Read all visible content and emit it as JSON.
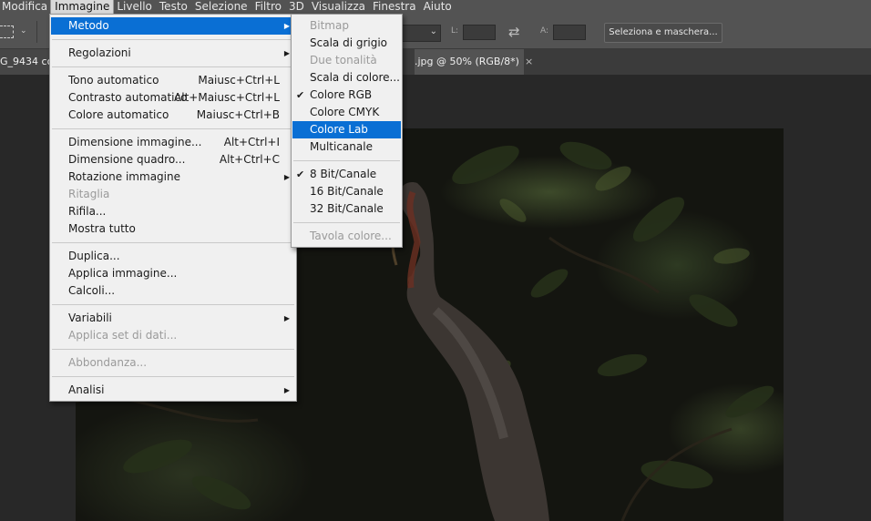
{
  "menubar": {
    "items": [
      "Modifica",
      "Immagine",
      "Livello",
      "Testo",
      "Selezione",
      "Filtro",
      "3D",
      "Visualizza",
      "Finestra",
      "Aiuto"
    ],
    "active_index": 1
  },
  "options_bar": {
    "width_label": "L:",
    "height_label": "A:",
    "select_mask_button": "Seleziona e maschera..."
  },
  "tabs": [
    {
      "label": "G_9434 co"
    },
    {
      "label": ".jpg @ 50% (RGB/8*)",
      "close": "×"
    }
  ],
  "image_menu": {
    "items": [
      {
        "label": "Metodo",
        "submenu": true,
        "highlighted": true
      },
      {
        "separator": true
      },
      {
        "label": "Regolazioni",
        "submenu": true
      },
      {
        "separator": true
      },
      {
        "label": "Tono automatico",
        "shortcut": "Maiusc+Ctrl+L"
      },
      {
        "label": "Contrasto automatico",
        "shortcut": "Alt+Maiusc+Ctrl+L"
      },
      {
        "label": "Colore automatico",
        "shortcut": "Maiusc+Ctrl+B"
      },
      {
        "separator": true
      },
      {
        "label": "Dimensione immagine...",
        "shortcut": "Alt+Ctrl+I"
      },
      {
        "label": "Dimensione quadro...",
        "shortcut": "Alt+Ctrl+C"
      },
      {
        "label": "Rotazione immagine",
        "submenu": true
      },
      {
        "label": "Ritaglia",
        "disabled": true
      },
      {
        "label": "Rifila..."
      },
      {
        "label": "Mostra tutto"
      },
      {
        "separator": true
      },
      {
        "label": "Duplica..."
      },
      {
        "label": "Applica immagine..."
      },
      {
        "label": "Calcoli..."
      },
      {
        "separator": true
      },
      {
        "label": "Variabili",
        "submenu": true
      },
      {
        "label": "Applica set di dati...",
        "disabled": true
      },
      {
        "separator": true
      },
      {
        "label": "Abbondanza...",
        "disabled": true
      },
      {
        "separator": true
      },
      {
        "label": "Analisi",
        "submenu": true
      }
    ]
  },
  "mode_submenu": {
    "items": [
      {
        "label": "Bitmap",
        "disabled": true
      },
      {
        "label": "Scala di grigio"
      },
      {
        "label": "Due tonalità",
        "disabled": true
      },
      {
        "label": "Scala di colore..."
      },
      {
        "label": "Colore RGB",
        "checked": true
      },
      {
        "label": "Colore CMYK"
      },
      {
        "label": "Colore Lab",
        "highlighted": true
      },
      {
        "label": "Multicanale"
      },
      {
        "separator": true
      },
      {
        "label": "8 Bit/Canale",
        "checked": true
      },
      {
        "label": "16 Bit/Canale"
      },
      {
        "label": "32 Bit/Canale"
      },
      {
        "separator": true
      },
      {
        "label": "Tavola colore...",
        "disabled": true
      }
    ]
  },
  "glyphs": {
    "check": "✔",
    "arrow": "▶",
    "chevron": "⌄",
    "swap": "⇄"
  },
  "colors": {
    "highlight": "#0a6fd4",
    "menubar": "#535353",
    "menu_bg": "#f0f0f0"
  }
}
